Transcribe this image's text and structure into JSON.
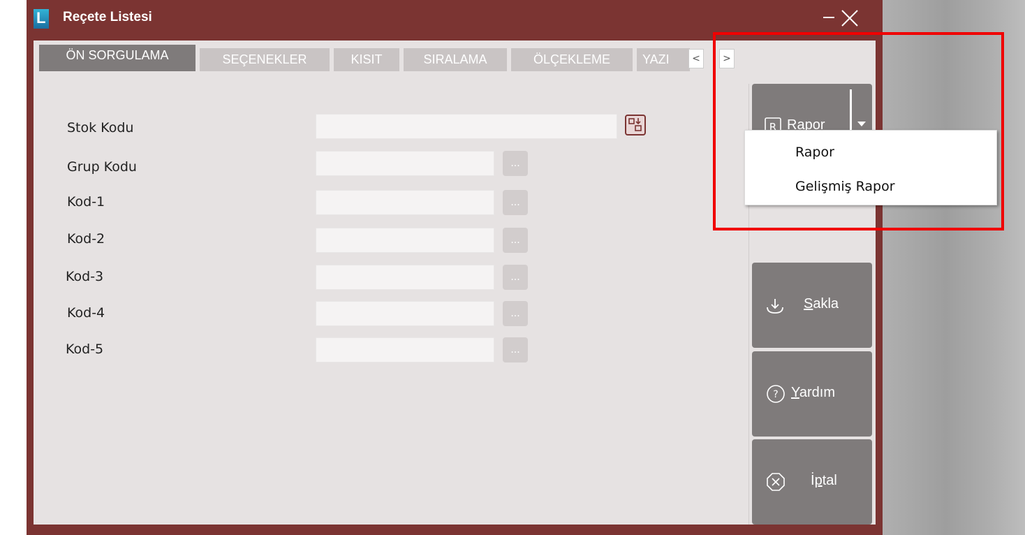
{
  "window": {
    "title": "Reçete Listesi",
    "logo_letter": "L",
    "minimize_icon": "minimize-icon",
    "close_icon": "close-icon"
  },
  "tabs": [
    {
      "label": "ÖN SORGULAMA",
      "active": true
    },
    {
      "label": "SEÇENEKLER",
      "active": false
    },
    {
      "label": "KISIT",
      "active": false
    },
    {
      "label": "SIRALAMA",
      "active": false
    },
    {
      "label": "ÖLÇEKLEME",
      "active": false
    },
    {
      "label": "YAZI",
      "active": false
    }
  ],
  "tab_scroll": {
    "left": "<",
    "right": ">"
  },
  "form": {
    "fields": [
      {
        "label": "Stok Kodu",
        "value": "",
        "button": "picker"
      },
      {
        "label": "Grup Kodu",
        "value": "",
        "button": "..."
      },
      {
        "label": "Kod-1",
        "value": "",
        "button": "..."
      },
      {
        "label": "Kod-2",
        "value": "",
        "button": "..."
      },
      {
        "label": "Kod-3",
        "value": "",
        "button": "..."
      },
      {
        "label": "Kod-4",
        "value": "",
        "button": "..."
      },
      {
        "label": "Kod-5",
        "value": "",
        "button": "..."
      }
    ]
  },
  "sidebar": {
    "rapor": {
      "mnemonic": "R",
      "rest": "apor",
      "icon": "report-icon"
    },
    "sakla": {
      "mnemonic": "S",
      "rest": "akla",
      "icon": "download-icon"
    },
    "yardim": {
      "mnemonic": "Y",
      "rest": "ardım",
      "icon": "help-icon"
    },
    "iptal": {
      "prefix": "İ",
      "mnemonic": "p",
      "rest": "tal",
      "icon": "cancel-icon"
    }
  },
  "dropdown_menu": {
    "items": [
      "Rapor",
      "Gelişmiş Rapor"
    ]
  },
  "colors": {
    "window_frame": "#7b3432",
    "tab_active": "#7f7b7b",
    "tab_inactive": "#c9c4c4",
    "highlight": "#f00000"
  }
}
